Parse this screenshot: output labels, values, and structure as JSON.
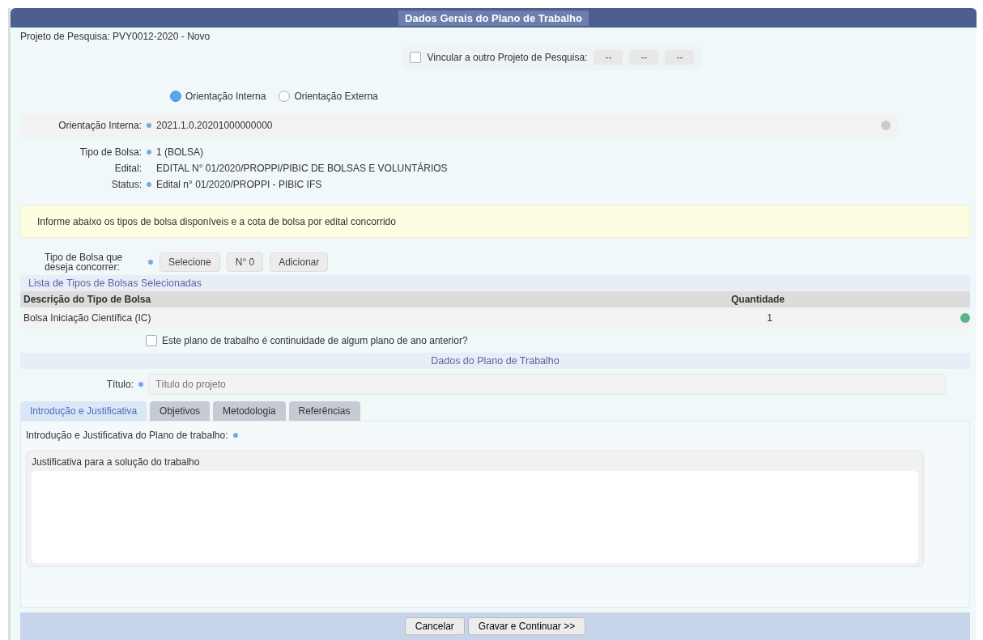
{
  "form": {
    "title": "Dados Gerais do Plano de Trabalho",
    "project": "Projeto de Pesquisa: PVY0012-2020 - Novo"
  },
  "link_project": {
    "label": "Vincular a outro Projeto de Pesquisa:",
    "checked": false,
    "selects": [
      "--",
      "--",
      "--"
    ]
  },
  "orientation": [
    {
      "label": "Orientação Interna",
      "selected": true
    },
    {
      "label": "Orientação Externa",
      "selected": false
    }
  ],
  "fields": [
    {
      "label": "Orientação Interna:",
      "required": true,
      "value": "2021.1.0.20201000000000",
      "kind": "select"
    },
    {
      "label": "Tipo de Bolsa:",
      "required": true,
      "value": "1 (BOLSA)",
      "kind": "text"
    },
    {
      "label": "Edital:",
      "required": false,
      "value": "EDITAL N° 01/2020/PROPPI/PIBIC DE BOLSAS E VOLUNTÁRIOS",
      "kind": "text"
    },
    {
      "label": "Status:",
      "required": true,
      "value": "Edital n° 01/2020/PROPPI - PIBIC IFS",
      "kind": "text"
    }
  ],
  "notice": "Informe abaixo os tipos de bolsa disponíveis e a cota de bolsa por edital concorrido",
  "bolsa_picker": {
    "label": "Tipo de Bolsa que deseja concorrer:",
    "required": true,
    "select": "Selecione",
    "quantity": "N° 0",
    "button": "Adicionar"
  },
  "bolsa_list": {
    "title": "Lista de Tipos de Bolsas Selecionadas",
    "columns": [
      "Descrição do Tipo de Bolsa",
      "Quantidade"
    ],
    "rows": [
      {
        "description": "Bolsa Iniciação Científica (IC)",
        "quantity": "1"
      }
    ]
  },
  "continuity": {
    "label": "Este plano de trabalho é continuidade de algum plano de ano anterior?",
    "checked": false
  },
  "plan": {
    "title": "Dados do Plano de Trabalho",
    "title_label": "Título:",
    "required": true,
    "title_placeholder": "Título do projeto"
  },
  "tabs": [
    {
      "label": "Introdução e Justificativa",
      "selected": true
    },
    {
      "label": "Objetivos",
      "selected": false
    },
    {
      "label": "Metodologia",
      "selected": false
    },
    {
      "label": "Referências",
      "selected": false
    }
  ],
  "editor": {
    "label": "Introdução e Justificativa do Plano de trabalho:",
    "required": true,
    "caption": "Justificativa para a solução do trabalho"
  },
  "buttons": [
    "Cancelar",
    "Gravar e Continuar >>"
  ]
}
